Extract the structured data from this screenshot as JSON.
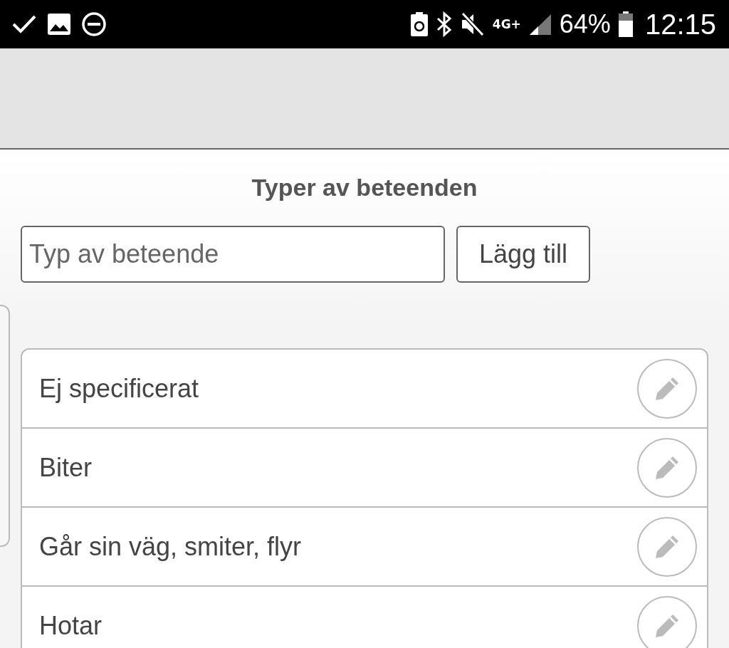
{
  "status_bar": {
    "network": "4G+",
    "battery": "64%",
    "time": "12:15"
  },
  "title": "Typer av beteenden",
  "new_type": {
    "placeholder": "Typ av beteende",
    "button": "Lägg till"
  },
  "items": [
    {
      "label": "Ej specificerat"
    },
    {
      "label": "Biter"
    },
    {
      "label": "Går sin väg, smiter, flyr"
    },
    {
      "label": "Hotar"
    }
  ]
}
